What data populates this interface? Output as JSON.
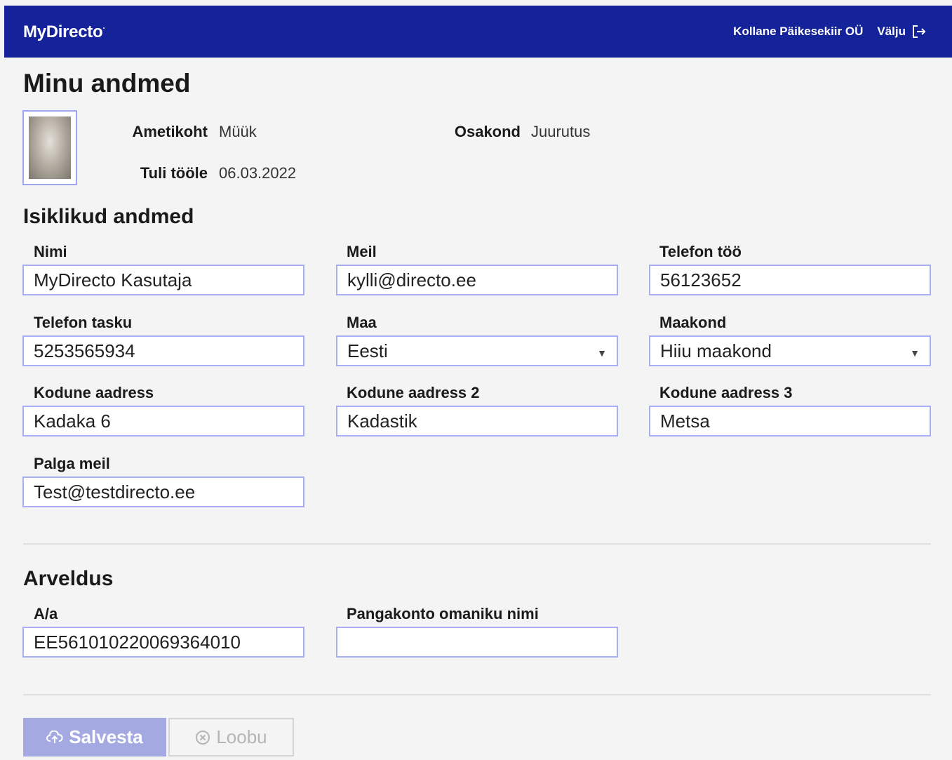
{
  "header": {
    "brand": "MyDirecto",
    "brand_mark": "·",
    "company": "Kollane Päikesekiir OÜ",
    "logout": "Välju",
    "logout_icon": "logout-icon"
  },
  "page": {
    "title": "Minu andmed"
  },
  "employee": {
    "position_label": "Ametikoht",
    "position_value": "Müük",
    "department_label": "Osakond",
    "department_value": "Juurutus",
    "start_label": "Tuli tööle",
    "start_value": "06.03.2022"
  },
  "personal": {
    "title": "Isiklikud andmed",
    "name_label": "Nimi",
    "name_value": "MyDirecto Kasutaja",
    "email_label": "Meil",
    "email_value": "kylli@directo.ee",
    "phone_work_label": "Telefon töö",
    "phone_work_value": "56123652",
    "phone_mobile_label": "Telefon tasku",
    "phone_mobile_value": "5253565934",
    "country_label": "Maa",
    "country_value": "Eesti",
    "county_label": "Maakond",
    "county_value": "Hiiu maakond",
    "address_label": "Kodune aadress",
    "address_value": "Kadaka 6",
    "address2_label": "Kodune aadress 2",
    "address2_value": "Kadastik",
    "address3_label": "Kodune aadress 3",
    "address3_value": "Metsa",
    "salary_email_label": "Palga meil",
    "salary_email_value": "Test@testdirecto.ee"
  },
  "billing": {
    "title": "Arveldus",
    "account_label": "A/a",
    "account_value": "EE561010220069364010",
    "owner_label": "Pangakonto omaniku nimi",
    "owner_value": ""
  },
  "actions": {
    "save": "Salvesta",
    "cancel": "Loobu",
    "save_icon": "cloud-upload-icon",
    "cancel_icon": "cancel-circle-icon"
  }
}
